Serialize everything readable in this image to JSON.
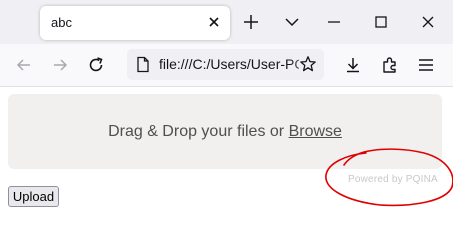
{
  "browser": {
    "tab_title": "abc",
    "url": "file:///C:/Users/User-PC/Desktop/index.html"
  },
  "page": {
    "drop_text": "Drag & Drop your files or ",
    "browse_link": "Browse",
    "powered_by": "Powered by PQINA",
    "upload_button": "Upload"
  },
  "colors": {
    "annotation": "#e00000",
    "dropzone_bg": "#f1f0ef",
    "tabstrip_bg": "#f0f0f4"
  }
}
